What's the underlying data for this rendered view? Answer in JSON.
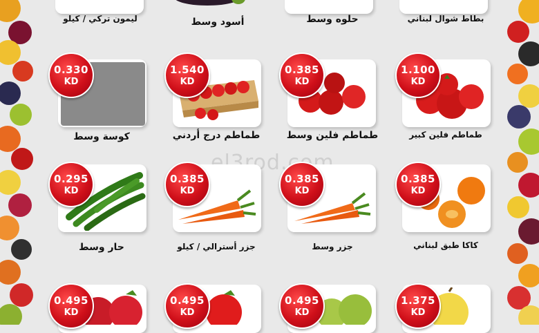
{
  "currency": "KD",
  "watermark": "el3rod.com",
  "top_row": [
    {
      "name": "بطاط شوال لبناني"
    },
    {
      "name": "حلوه وسط"
    },
    {
      "name": "أسود وسط"
    },
    {
      "name": "ليمون تركي / كيلو"
    }
  ],
  "row1": [
    {
      "name": "طماطم فلين كبير",
      "price": "1.100"
    },
    {
      "name": "طماطم فلين وسط",
      "price": "0.385"
    },
    {
      "name": "طماطم درج أردني",
      "price": "1.540"
    },
    {
      "name": "كوسة وسط",
      "price": "0.330"
    }
  ],
  "row2": [
    {
      "name": "كاكا طبق لبناني",
      "price": "0.385"
    },
    {
      "name": "جزر وسط",
      "price": "0.385"
    },
    {
      "name": "جزر أسترالي / كيلو",
      "price": "0.385"
    },
    {
      "name": "حار وسط",
      "price": "0.295"
    }
  ],
  "row3": [
    {
      "price": "1.375"
    },
    {
      "price": "0.495"
    },
    {
      "price": "0.495"
    },
    {
      "price": "0.495"
    }
  ],
  "colors": {
    "badge": "#d0101a",
    "card": "#ffffff",
    "background": "#e9e9e9"
  }
}
